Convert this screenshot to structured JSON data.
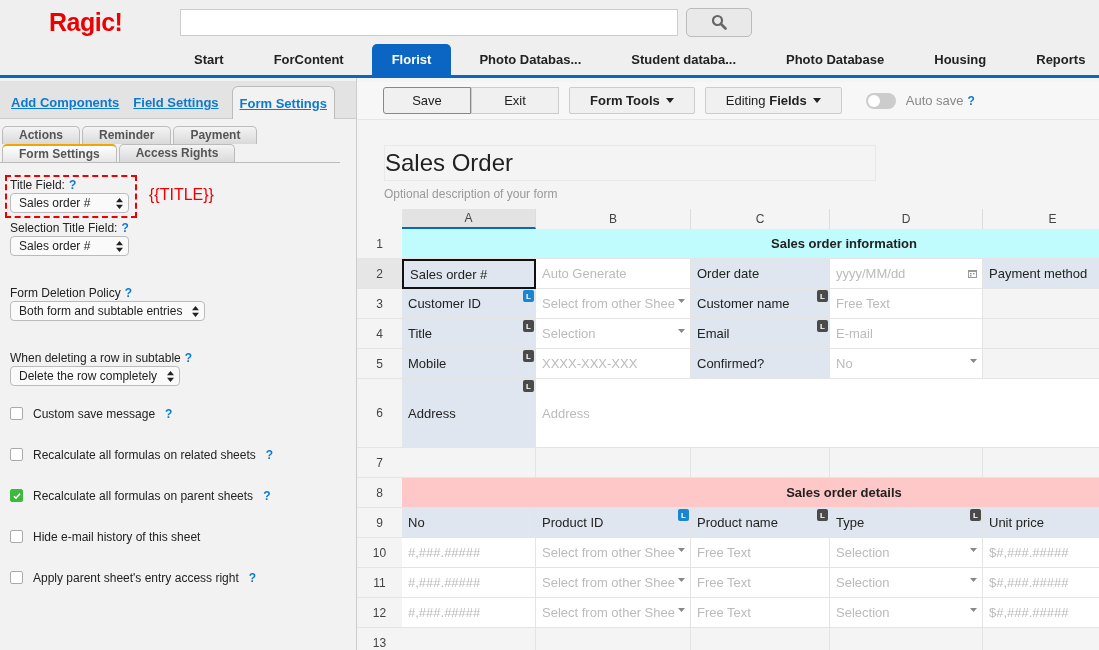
{
  "header": {
    "logo": "Ragic!"
  },
  "tabs": [
    {
      "label": "Start",
      "selected": false
    },
    {
      "label": "ForContent",
      "selected": false
    },
    {
      "label": "Florist",
      "selected": true
    },
    {
      "label": "Photo Databas...",
      "selected": false
    },
    {
      "label": "Student databa...",
      "selected": false
    },
    {
      "label": "Photo Database",
      "selected": false
    },
    {
      "label": "Housing",
      "selected": false
    },
    {
      "label": "Reports",
      "selected": false
    }
  ],
  "panel": {
    "tabs": [
      {
        "label": "Add Components",
        "selected": false
      },
      {
        "label": "Field Settings",
        "selected": false
      },
      {
        "label": "Form Settings",
        "selected": true
      }
    ],
    "subtab_rows": [
      [
        {
          "label": "Actions",
          "selected": false
        },
        {
          "label": "Reminder",
          "selected": false
        },
        {
          "label": "Payment",
          "selected": false
        }
      ],
      [
        {
          "label": "Form Settings",
          "selected": true
        },
        {
          "label": "Access Rights",
          "selected": false
        }
      ]
    ],
    "settings": [
      {
        "kind": "select",
        "label": "Title Field:",
        "help": "?",
        "value": "Sales order #",
        "highlighted": true,
        "annotation": "{{TITLE}}"
      },
      {
        "kind": "select",
        "label": "Selection Title Field:",
        "help": "?",
        "value": "Sales order #",
        "highlighted": false
      },
      {
        "kind": "select",
        "label": "Form Deletion Policy",
        "help": "?",
        "value": "Both form and subtable entries",
        "highlighted": false
      },
      {
        "kind": "select",
        "label": "When deleting a row in subtable",
        "help": "?",
        "value": "Delete the row completely",
        "highlighted": false
      },
      {
        "kind": "checkbox",
        "label": "Custom save message",
        "help": "?",
        "checked": false
      },
      {
        "kind": "checkbox",
        "label": "Recalculate all formulas on related sheets",
        "help": "?",
        "checked": false
      },
      {
        "kind": "checkbox",
        "label": "Recalculate all formulas on parent sheets",
        "help": "?",
        "checked": true
      },
      {
        "kind": "checkbox",
        "label": "Hide e-mail history of this sheet",
        "checked": false
      },
      {
        "kind": "checkbox",
        "label": "Apply parent sheet's entry access right",
        "help": "?",
        "checked": false
      }
    ]
  },
  "toolbar": {
    "buttons": [
      {
        "label": "Save",
        "default": true
      },
      {
        "label": "Exit",
        "default": false
      }
    ],
    "menus": [
      {
        "label": "Form Tools",
        "kind": "bold"
      },
      {
        "label": "Editing **Fields**",
        "kind": "mixed"
      }
    ],
    "auto_save": {
      "label": "Auto save",
      "help": "?",
      "on": false
    }
  },
  "form": {
    "title": "Sales Order",
    "description": "Optional description of your form"
  },
  "sheet": {
    "columns": [
      {
        "label": "A",
        "selected": true
      },
      {
        "label": "B",
        "selected": false
      },
      {
        "label": "C",
        "selected": false
      },
      {
        "label": "D",
        "selected": false
      },
      {
        "label": "E",
        "selected": false
      }
    ],
    "rows": [
      {
        "number": "1",
        "selected": false,
        "tall": false,
        "cells": [
          {
            "kind": "section",
            "text": "Sales order information",
            "color": "#c0fbfd"
          }
        ]
      },
      {
        "number": "2",
        "selected": true,
        "tall": false,
        "cells": [
          {
            "kind": "label",
            "text": "Sales order #"
          },
          {
            "kind": "input",
            "placeholder": "Auto Generate"
          },
          {
            "kind": "label",
            "text": "Order date"
          },
          {
            "kind": "input",
            "placeholder": "yyyy/MM/dd",
            "calendar": true
          },
          {
            "kind": "label",
            "text": "Payment method"
          }
        ]
      },
      {
        "number": "3",
        "selected": false,
        "tall": false,
        "cells": [
          {
            "kind": "label",
            "text": "Customer ID",
            "badge": {
              "text": "L",
              "color": "#1a86d0"
            }
          },
          {
            "kind": "input",
            "placeholder": "Select from other Shee",
            "caret": true
          },
          {
            "kind": "label",
            "text": "Customer name",
            "badge": {
              "text": "L",
              "color": "#4a4a4a"
            }
          },
          {
            "kind": "input",
            "placeholder": "Free Text"
          },
          {
            "kind": "empty"
          }
        ]
      },
      {
        "number": "4",
        "selected": false,
        "tall": false,
        "cells": [
          {
            "kind": "label",
            "text": "Title",
            "badge": {
              "text": "L",
              "color": "#4a4a4a"
            }
          },
          {
            "kind": "input",
            "placeholder": "Selection",
            "caret": true
          },
          {
            "kind": "label",
            "text": "Email",
            "badge": {
              "text": "L",
              "color": "#4a4a4a"
            }
          },
          {
            "kind": "input",
            "placeholder": "E-mail"
          },
          {
            "kind": "empty"
          }
        ]
      },
      {
        "number": "5",
        "selected": false,
        "tall": false,
        "cells": [
          {
            "kind": "label",
            "text": "Mobile",
            "badge": {
              "text": "L",
              "color": "#4a4a4a"
            }
          },
          {
            "kind": "input",
            "placeholder": "XXXX-XXX-XXX"
          },
          {
            "kind": "label",
            "text": "Confirmed?"
          },
          {
            "kind": "input",
            "placeholder": "No",
            "caret": true
          },
          {
            "kind": "empty"
          }
        ]
      },
      {
        "number": "6",
        "selected": false,
        "tall": true,
        "cells": [
          {
            "kind": "label",
            "text": "Address",
            "badge": {
              "text": "L",
              "color": "#4a4a4a"
            }
          },
          {
            "kind": "input",
            "placeholder": "Address"
          }
        ]
      },
      {
        "number": "7",
        "selected": false,
        "tall": false,
        "cells": [
          {
            "kind": "empty"
          },
          {
            "kind": "empty"
          },
          {
            "kind": "empty"
          },
          {
            "kind": "empty"
          },
          {
            "kind": "empty"
          }
        ]
      },
      {
        "number": "8",
        "selected": false,
        "tall": false,
        "cells": [
          {
            "kind": "section",
            "text": "Sales order details",
            "color": "#ffc8c8"
          }
        ]
      },
      {
        "number": "9",
        "selected": false,
        "tall": false,
        "cells": [
          {
            "kind": "label",
            "text": "No"
          },
          {
            "kind": "label",
            "text": "Product ID",
            "badge": {
              "text": "L",
              "color": "#1a86d0"
            }
          },
          {
            "kind": "label",
            "text": "Product name",
            "badge": {
              "text": "L",
              "color": "#4a4a4a"
            }
          },
          {
            "kind": "label",
            "text": "Type",
            "badge": {
              "text": "L",
              "color": "#4a4a4a"
            }
          },
          {
            "kind": "label",
            "text": "Unit price"
          }
        ]
      },
      {
        "number": "10",
        "selected": false,
        "tall": false,
        "cells": [
          {
            "kind": "input",
            "placeholder": "#,###.#####"
          },
          {
            "kind": "input",
            "placeholder": "Select from other Shee",
            "caret": true
          },
          {
            "kind": "input",
            "placeholder": "Free Text"
          },
          {
            "kind": "input",
            "placeholder": "Selection",
            "caret": true
          },
          {
            "kind": "input",
            "placeholder": "$#,###.#####"
          }
        ]
      },
      {
        "number": "11",
        "selected": false,
        "tall": false,
        "cells": [
          {
            "kind": "input",
            "placeholder": "#,###.#####"
          },
          {
            "kind": "input",
            "placeholder": "Select from other Shee",
            "caret": true
          },
          {
            "kind": "input",
            "placeholder": "Free Text"
          },
          {
            "kind": "input",
            "placeholder": "Selection",
            "caret": true
          },
          {
            "kind": "input",
            "placeholder": "$#,###.#####"
          }
        ]
      },
      {
        "number": "12",
        "selected": false,
        "tall": false,
        "cells": [
          {
            "kind": "input",
            "placeholder": "#,###.#####"
          },
          {
            "kind": "input",
            "placeholder": "Select from other Shee",
            "caret": true
          },
          {
            "kind": "input",
            "placeholder": "Free Text"
          },
          {
            "kind": "input",
            "placeholder": "Selection",
            "caret": true
          },
          {
            "kind": "input",
            "placeholder": "$#,###.#####"
          }
        ]
      },
      {
        "number": "13",
        "selected": false,
        "tall": false,
        "cells": [
          {
            "kind": "empty"
          },
          {
            "kind": "empty"
          },
          {
            "kind": "empty"
          },
          {
            "kind": "empty"
          },
          {
            "kind": "empty"
          }
        ]
      }
    ]
  }
}
